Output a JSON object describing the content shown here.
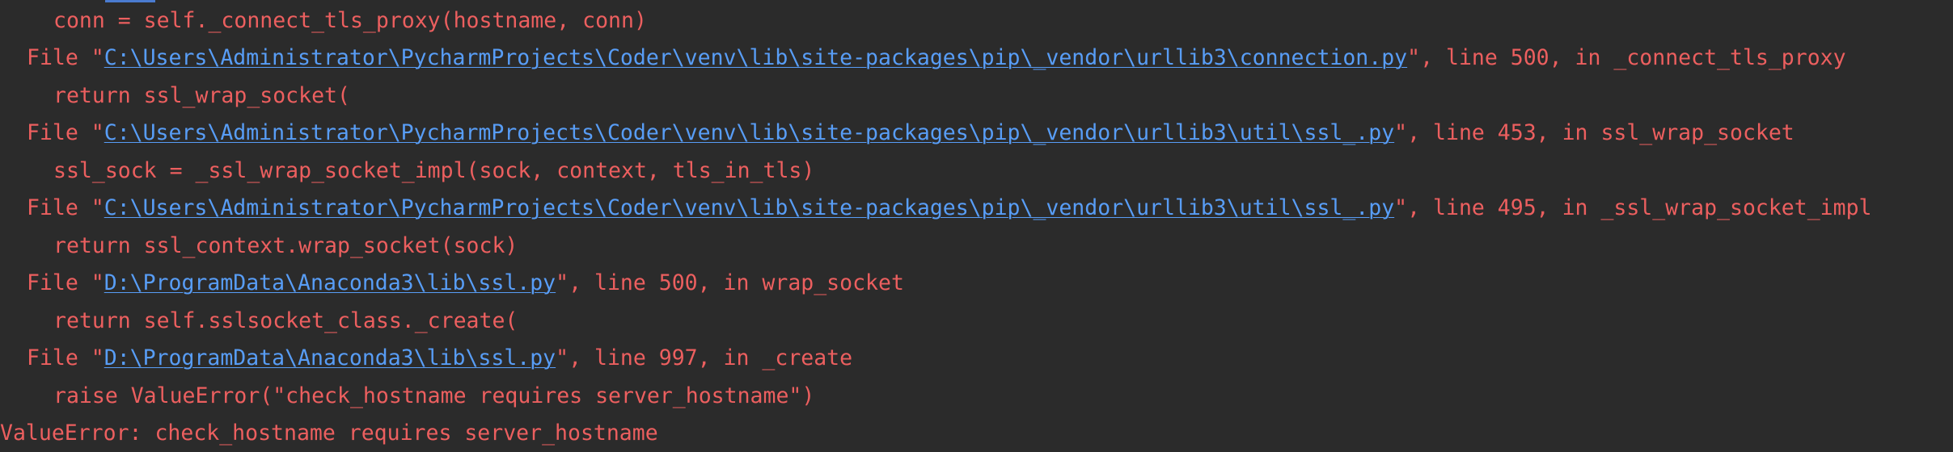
{
  "console": {
    "lines": [
      {
        "kind": "code",
        "text": "conn = self._connect_tls_proxy(hostname, conn)"
      },
      {
        "kind": "file",
        "prefix": "File \"",
        "path": "C:\\Users\\Administrator\\PycharmProjects\\Coder\\venv\\lib\\site-packages\\pip\\_vendor\\urllib3\\connection.py",
        "suffix": "\", line 500, in _connect_tls_proxy"
      },
      {
        "kind": "code",
        "text": "return ssl_wrap_socket("
      },
      {
        "kind": "file",
        "prefix": "File \"",
        "path": "C:\\Users\\Administrator\\PycharmProjects\\Coder\\venv\\lib\\site-packages\\pip\\_vendor\\urllib3\\util\\ssl_.py",
        "suffix": "\", line 453, in ssl_wrap_socket"
      },
      {
        "kind": "code",
        "text": "ssl_sock = _ssl_wrap_socket_impl(sock, context, tls_in_tls)"
      },
      {
        "kind": "file",
        "prefix": "File \"",
        "path": "C:\\Users\\Administrator\\PycharmProjects\\Coder\\venv\\lib\\site-packages\\pip\\_vendor\\urllib3\\util\\ssl_.py",
        "suffix": "\", line 495, in _ssl_wrap_socket_impl"
      },
      {
        "kind": "code",
        "text": "return ssl_context.wrap_socket(sock)"
      },
      {
        "kind": "file",
        "prefix": "File \"",
        "path": "D:\\ProgramData\\Anaconda3\\lib\\ssl.py",
        "suffix": "\", line 500, in wrap_socket"
      },
      {
        "kind": "code",
        "text": "return self.sslsocket_class._create("
      },
      {
        "kind": "file",
        "prefix": "File \"",
        "path": "D:\\ProgramData\\Anaconda3\\lib\\ssl.py",
        "suffix": "\", line 997, in _create"
      },
      {
        "kind": "code",
        "text": "raise ValueError(\"check_hostname requires server_hostname\")"
      },
      {
        "kind": "error",
        "text": "ValueError: check_hostname requires server_hostname"
      }
    ]
  },
  "colors": {
    "background": "#2b2b2b",
    "error_text": "#ec5f5f",
    "link": "#589df6",
    "scroll_thumb": "#4a7bd0"
  }
}
